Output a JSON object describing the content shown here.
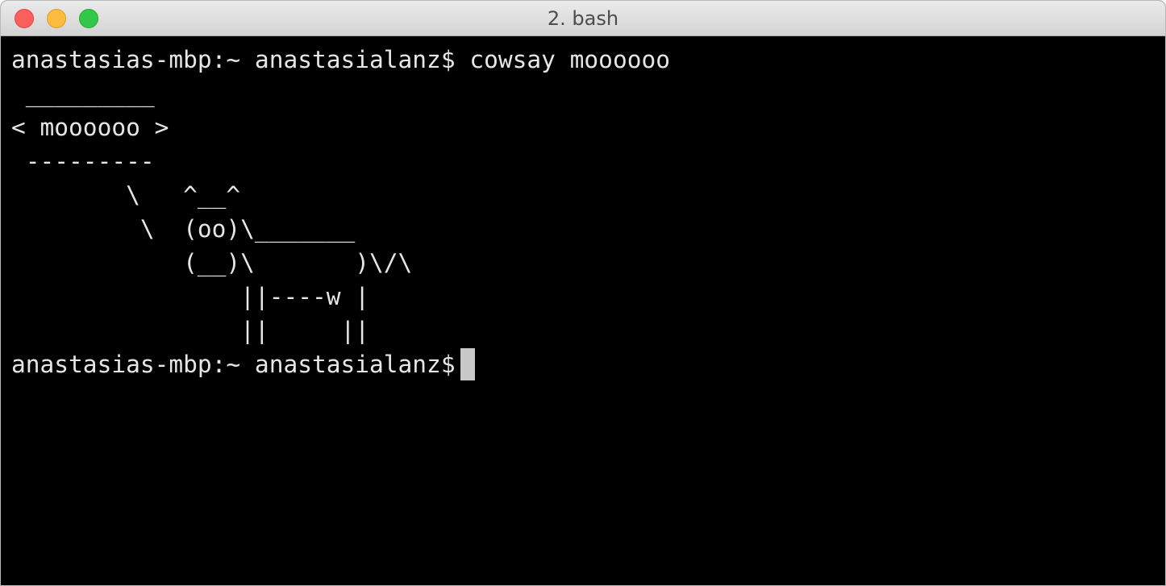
{
  "window": {
    "title": "2. bash"
  },
  "terminal": {
    "lines": [
      "anastasias-mbp:~ anastasialanz$ cowsay moooooo",
      " _________",
      "< moooooo >",
      " ---------",
      "        \\   ^__^",
      "         \\  (oo)\\_______",
      "            (__)\\       )\\/\\",
      "                ||----w |",
      "                ||     ||",
      "anastasias-mbp:~ anastasialanz$"
    ]
  },
  "colors": {
    "background": "#000000",
    "foreground": "#e6e6e6",
    "cursor": "#c8c8c8",
    "close_button": "#fc605c",
    "minimize_button": "#fdbc40",
    "zoom_button": "#34c84a"
  }
}
